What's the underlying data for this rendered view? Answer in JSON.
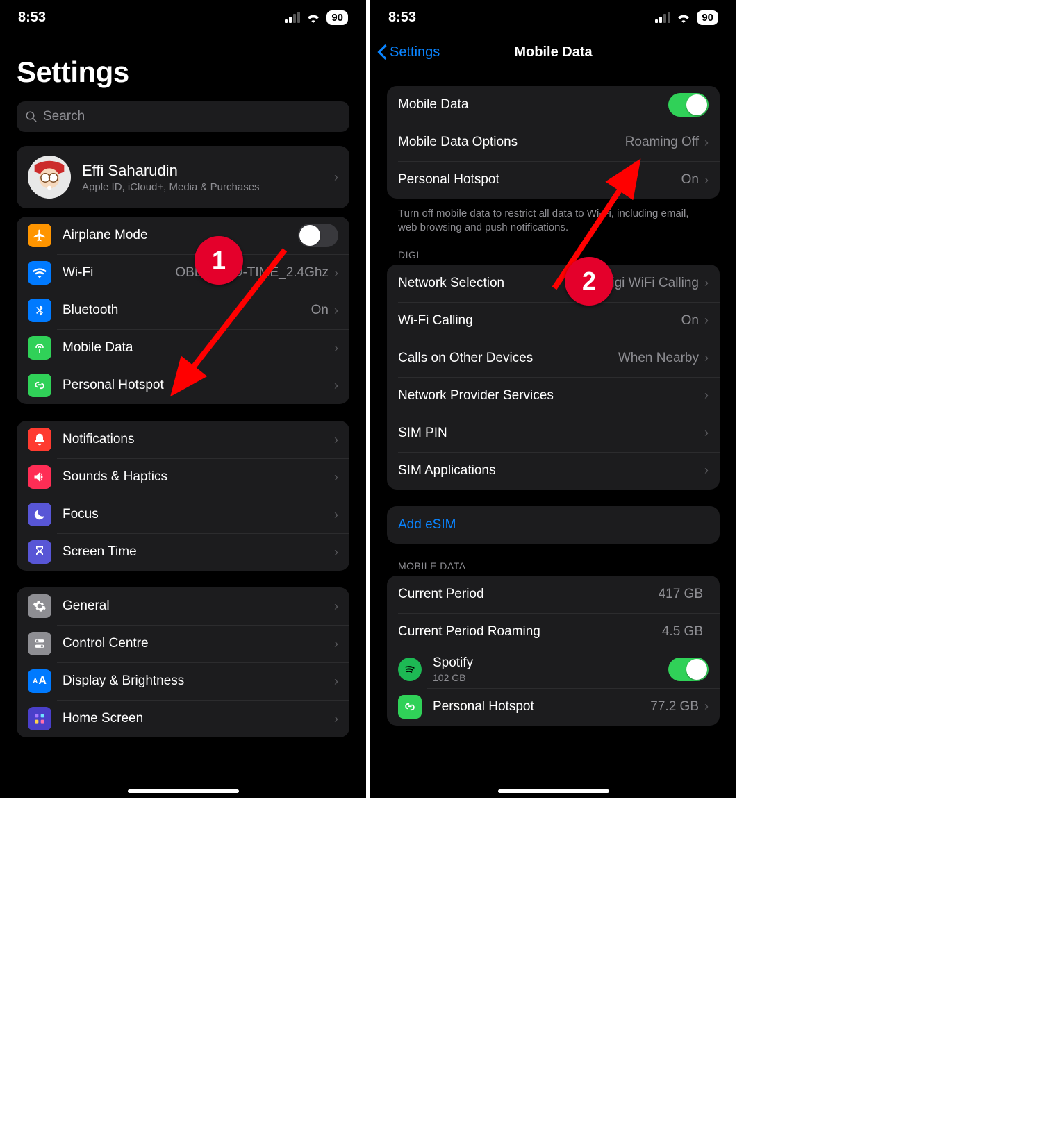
{
  "status": {
    "time": "8:53",
    "battery": "90"
  },
  "left": {
    "title": "Settings",
    "search_placeholder": "Search",
    "profile": {
      "name": "Effi Saharudin",
      "subtitle": "Apple ID, iCloud+, Media & Purchases"
    },
    "g1": {
      "airplane": "Airplane Mode",
      "wifi": "Wi-Fi",
      "wifi_value": "OBEFIEND-TIME_2.4Ghz",
      "bluetooth": "Bluetooth",
      "bluetooth_value": "On",
      "mobile_data": "Mobile Data",
      "hotspot": "Personal Hotspot"
    },
    "g2": {
      "notifications": "Notifications",
      "sounds": "Sounds & Haptics",
      "focus": "Focus",
      "screentime": "Screen Time"
    },
    "g3": {
      "general": "General",
      "control": "Control Centre",
      "display": "Display & Brightness",
      "home": "Home Screen"
    }
  },
  "right": {
    "back": "Settings",
    "title": "Mobile Data",
    "g1": {
      "mobile_data": "Mobile Data",
      "options": "Mobile Data Options",
      "options_value": "Roaming Off",
      "hotspot": "Personal Hotspot",
      "hotspot_value": "On"
    },
    "g1_footer": "Turn off mobile data to restrict all data to Wi-Fi, including email, web browsing and push notifications.",
    "g2_header": "DIGI",
    "g2": {
      "network_sel": "Network Selection",
      "network_sel_value": "Digi WiFi Calling",
      "wifi_calling": "Wi-Fi Calling",
      "wifi_calling_value": "On",
      "calls_other": "Calls on Other Devices",
      "calls_other_value": "When Nearby",
      "provider": "Network Provider Services",
      "simpin": "SIM PIN",
      "simapps": "SIM Applications"
    },
    "add_esim": "Add eSIM",
    "g3_header": "MOBILE DATA",
    "g3": {
      "current_period": "Current Period",
      "current_period_value": "417 GB",
      "roaming": "Current Period Roaming",
      "roaming_value": "4.5 GB",
      "spotify": "Spotify",
      "spotify_sub": "102 GB",
      "ph": "Personal Hotspot",
      "ph_value": "77.2 GB"
    }
  },
  "annotations": {
    "one": "1",
    "two": "2"
  }
}
